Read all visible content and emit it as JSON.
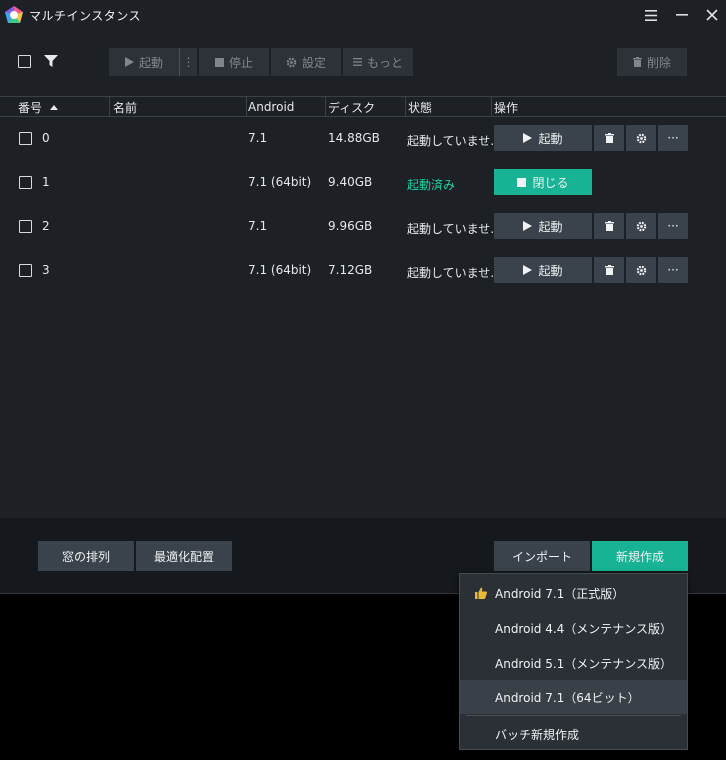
{
  "window": {
    "title": "マルチインスタンス",
    "controls": [
      "menu-icon",
      "minimize-icon",
      "close-icon"
    ]
  },
  "toolbar": {
    "start_label": "起動",
    "more_sep": "⋮",
    "stop_label": "停止",
    "settings_label": "設定",
    "more_label": "もっと",
    "delete_label": "削除"
  },
  "table": {
    "headers": {
      "number": "番号",
      "name": "名前",
      "android": "Android",
      "disk": "ディスク",
      "status": "状態",
      "actions": "操作"
    },
    "rows": [
      {
        "number": "0",
        "name": "",
        "android": "7.1",
        "disk": "14.88GB",
        "status": "起動していませ…",
        "running": false,
        "action_label": "起動"
      },
      {
        "number": "1",
        "name": "",
        "android": "7.1 (64bit)",
        "disk": "9.40GB",
        "status": "起動済み",
        "running": true,
        "action_label": "閉じる"
      },
      {
        "number": "2",
        "name": "",
        "android": "7.1",
        "disk": "9.96GB",
        "status": "起動していませ…",
        "running": false,
        "action_label": "起動"
      },
      {
        "number": "3",
        "name": "",
        "android": "7.1 (64bit)",
        "disk": "7.12GB",
        "status": "起動していませ…",
        "running": false,
        "action_label": "起動"
      }
    ],
    "more_glyph": "···"
  },
  "footer": {
    "arrange_label": "窓の排列",
    "optimize_label": "最適化配置",
    "import_label": "インポート",
    "new_label": "新規作成"
  },
  "dropdown": {
    "items": [
      {
        "label": "Android 7.1（正式版）",
        "recommended": true
      },
      {
        "label": "Android 4.4（メンテナンス版）",
        "recommended": false
      },
      {
        "label": "Android 5.1（メンテナンス版）",
        "recommended": false
      },
      {
        "label": "Android 7.1（64ビット）",
        "recommended": false,
        "hover": true
      }
    ],
    "batch_label": "バッチ新規作成"
  },
  "colors": {
    "accent": "#17b394",
    "running_text": "#1bd3a5",
    "panel": "#1d2126",
    "button": "#3a434b"
  }
}
